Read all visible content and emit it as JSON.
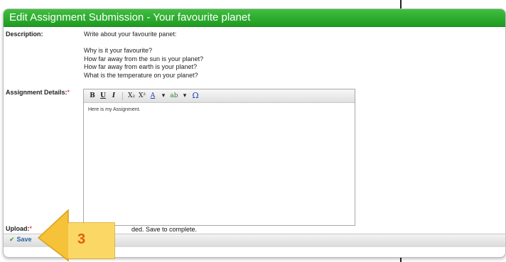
{
  "dialog": {
    "title": "Edit Assignment Submission - Your favourite planet",
    "description_label": "Description:",
    "description_text": "Write about your favourite panet:\n\nWhy is it your favourite?\nHow far away from the sun is your planet?\nHow far away from earth is your planet?\nWhat is the temperature on your planet?",
    "details_label": "Assignment Details:",
    "required_marker": "*",
    "editor_content": "Here is my Assignment.",
    "upload_label": "Upload:",
    "upload_status": "ded. Save to complete.",
    "save_label": "Save"
  },
  "toolbar": [
    "B",
    "U",
    "I",
    "X₂",
    "X²",
    "A",
    "ab",
    "Ω"
  ],
  "callout": {
    "number": "3",
    "color": "#f5c23a"
  }
}
